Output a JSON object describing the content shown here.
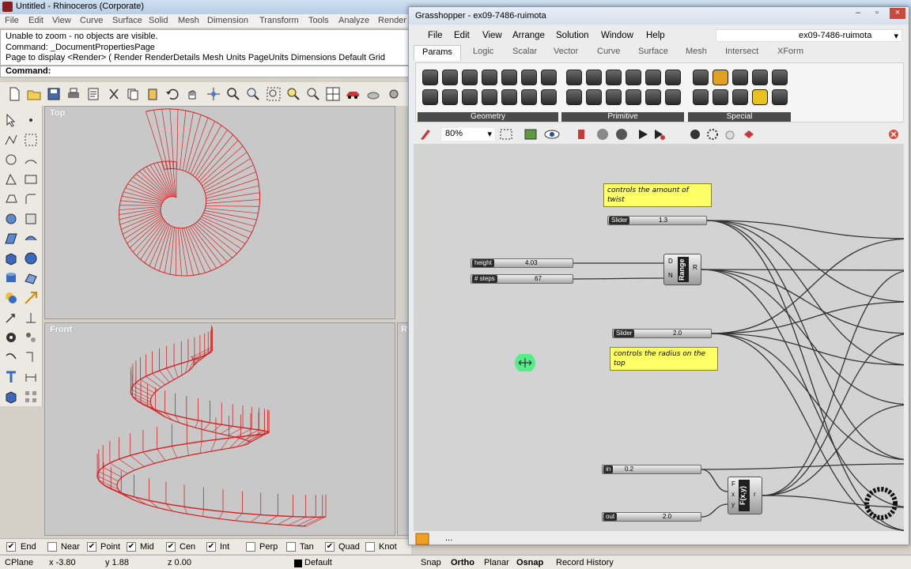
{
  "rhino": {
    "title": "Untitled - Rhinoceros (Corporate)",
    "menu": [
      "File",
      "Edit",
      "View",
      "Curve",
      "Surface",
      "Solid",
      "Mesh",
      "Dimension",
      "Transform",
      "Tools",
      "Analyze",
      "Render"
    ],
    "command_history": [
      "Unable to zoom - no objects are visible.",
      "Command: _DocumentPropertiesPage",
      "Page to display <Render> ( Render  RenderDetails  Mesh  Units  PageUnits  Dimensions  Default  Grid"
    ],
    "command_prompt": "Command:",
    "viewports": {
      "top": "Top",
      "front": "Front",
      "right_partial": "R"
    },
    "osnap": [
      {
        "label": "End",
        "checked": true
      },
      {
        "label": "Near",
        "checked": false
      },
      {
        "label": "Point",
        "checked": true
      },
      {
        "label": "Mid",
        "checked": true
      },
      {
        "label": "Cen",
        "checked": true
      },
      {
        "label": "Int",
        "checked": true
      },
      {
        "label": "Perp",
        "checked": false
      },
      {
        "label": "Tan",
        "checked": false
      },
      {
        "label": "Quad",
        "checked": true
      },
      {
        "label": "Knot",
        "checked": false
      }
    ],
    "status": {
      "cplane": "CPlane",
      "x": "x -3.80",
      "y": "y 1.88",
      "z": "z 0.00",
      "layer": "Default",
      "snap": "Snap",
      "ortho": "Ortho",
      "planar": "Planar",
      "osnap": "Osnap",
      "record": "Record History"
    },
    "accent": "#d32323"
  },
  "gh": {
    "title": "Grasshopper - ex09-7486-ruimota",
    "menu": [
      "File",
      "Edit",
      "View",
      "Arrange",
      "Solution",
      "Window",
      "Help"
    ],
    "doc_name": "ex09-7486-ruimota",
    "tabs": [
      "Params",
      "Logic",
      "Scalar",
      "Vector",
      "Curve",
      "Surface",
      "Mesh",
      "Intersect",
      "XForm"
    ],
    "groups": [
      "Geometry",
      "Primitive",
      "Special"
    ],
    "zoom": "80%",
    "notes": {
      "twist": "controls the amount of twist",
      "radius": "controls the radius on the top"
    },
    "sliders": {
      "s1": {
        "name": "Slider",
        "value": "1.3"
      },
      "height": {
        "name": "height",
        "value": "4.03"
      },
      "steps": {
        "name": "# steps",
        "value": "67"
      },
      "s2": {
        "name": "Slider",
        "value": "2.0"
      },
      "in": {
        "name": "in",
        "value": "0.2"
      },
      "out": {
        "name": "out",
        "value": "2.0"
      }
    },
    "range": {
      "label": "Range",
      "in_d": "D",
      "in_n": "N",
      "out_r": "R"
    },
    "fxy": {
      "label": "F(x,y)",
      "in_f": "F",
      "in_x": "x",
      "in_y": "y",
      "out_r": "r"
    },
    "bottom_text": "..."
  }
}
